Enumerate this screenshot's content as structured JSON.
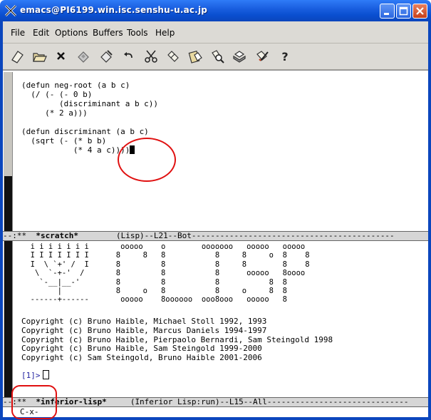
{
  "window": {
    "title": "emacs@PI6199.win.isc.senshu-u.ac.jp",
    "controls": [
      "minimize-icon",
      "maximize-icon",
      "close-icon"
    ]
  },
  "menubar": {
    "items": [
      "File",
      "Edit",
      "Options",
      "Buffers",
      "Tools",
      "Help"
    ]
  },
  "toolbar": {
    "icons": [
      "new-file-icon",
      "open-folder-icon",
      "close-buffer-icon",
      "save-disk-icon",
      "save-as-icon",
      "undo-icon",
      "cut-icon",
      "copy-icon",
      "paste-icon",
      "search-icon",
      "print-icon",
      "customize-icon",
      "help-icon"
    ]
  },
  "editor": {
    "code_lines": [
      "(defun neg-root (a b c)",
      "  (/ (- (- 0 b)",
      "        (discriminant a b c))",
      "     (* 2 a)))",
      "",
      "(defun discriminant (a b c)",
      "  (sqrt (- (* b b)",
      "           (* 4 a c))))"
    ]
  },
  "modeline_upper": {
    "prefix": "--:**  ",
    "buffer": "*scratch*",
    "rest": "        (Lisp)--L21--Bot-------------------------------------------"
  },
  "lisp": {
    "banner_lines": [
      "  i i i i i i i       ooooo    o        ooooooo   ooooo   ooooo",
      "  I I I I I I I      8     8   8           8     8     o  8    8",
      "  I  \\ `+' /  I      8         8           8     8        8    8",
      "   \\  `-+-'  /       8         8           8      ooooo   8oooo",
      "    `-__|__-'        8         8           8           8  8",
      "        |            8     o   8           8     o     8  8",
      "  ------+------       ooooo    8oooooo  ooo8ooo   ooooo   8"
    ],
    "copyright_lines": [
      "Copyright (c) Bruno Haible, Michael Stoll 1992, 1993",
      "Copyright (c) Bruno Haible, Marcus Daniels 1994-1997",
      "Copyright (c) Bruno Haible, Pierpaolo Bernardi, Sam Steingold 1998",
      "Copyright (c) Bruno Haible, Sam Steingold 1999-2000",
      "Copyright (c) Sam Steingold, Bruno Haible 2001-2006"
    ],
    "prompt": "[1]>"
  },
  "modeline_lower": {
    "prefix": "--:**  ",
    "buffer": "*inferior-lisp*",
    "rest": "     (Inferior Lisp:run)--L15--All------------------------------"
  },
  "minibuffer": {
    "text": "C-x-"
  },
  "colors": {
    "titlebar": "#0a4fd0",
    "annotation": "#e01010",
    "prompt": "#2020a0"
  }
}
